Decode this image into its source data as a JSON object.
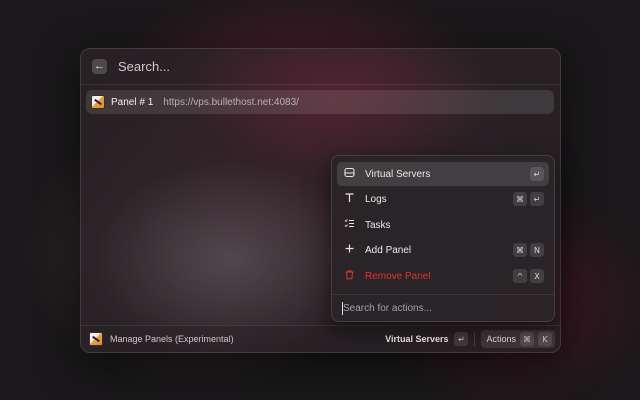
{
  "search": {
    "placeholder": "Search..."
  },
  "result": {
    "title": "Panel # 1",
    "url": "https://vps.bullethost.net:4083/"
  },
  "actions": {
    "items": [
      {
        "label": "Virtual Servers",
        "icon": "server-icon",
        "shortcut": [
          "↵"
        ],
        "selected": true
      },
      {
        "label": "Logs",
        "icon": "text-icon",
        "shortcut": [
          "⌘",
          "↵"
        ]
      },
      {
        "label": "Tasks",
        "icon": "checklist-icon",
        "shortcut": []
      },
      {
        "label": "Add Panel",
        "icon": "plus-icon",
        "shortcut": [
          "⌘",
          "N"
        ]
      },
      {
        "label": "Remove Panel",
        "icon": "trash-icon",
        "shortcut": [
          "^",
          "X"
        ],
        "danger": true,
        "color": "#e3332f"
      }
    ],
    "search_placeholder": "Search for actions..."
  },
  "footer": {
    "title": "Manage Panels (Experimental)",
    "primary_action": "Virtual Servers",
    "primary_key": "↵",
    "actions_label": "Actions",
    "actions_keys": [
      "⌘",
      "K"
    ]
  }
}
